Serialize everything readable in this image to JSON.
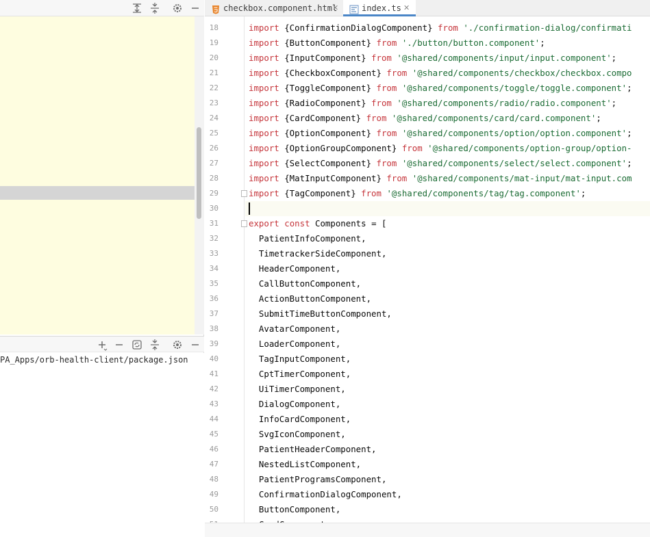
{
  "left_panel": {
    "top_toolbar_icons": [
      "expand-all-icon",
      "collapse-all-icon",
      "gear-icon",
      "minimize-icon"
    ],
    "bottom_toolbar_icons": [
      "add-icon",
      "remove-icon",
      "refresh-icon",
      "collapse-all-icon",
      "gear-icon",
      "minimize-icon"
    ],
    "package_path": "PA_Apps/orb-health-client/package.json"
  },
  "tabs": [
    {
      "label": "checkbox.component.html",
      "icon": "html-file-icon",
      "active": false
    },
    {
      "label": "index.ts",
      "icon": "ts-file-icon",
      "active": true
    }
  ],
  "editor": {
    "current_line": 30,
    "lines": [
      {
        "n": "18",
        "kind": "import",
        "name": "{ConfirmationDialogComponent}",
        "path": "'./confirmation-dialog/confirmati"
      },
      {
        "n": "19",
        "kind": "import",
        "name": "{ButtonComponent}",
        "path": "'./button/button.component'",
        "tail": ";"
      },
      {
        "n": "20",
        "kind": "import",
        "name": "{InputComponent}",
        "path": "'@shared/components/input/input.component'",
        "tail": ";"
      },
      {
        "n": "21",
        "kind": "import",
        "name": "{CheckboxComponent}",
        "path": "'@shared/components/checkbox/checkbox.compo"
      },
      {
        "n": "22",
        "kind": "import",
        "name": "{ToggleComponent}",
        "path": "'@shared/components/toggle/toggle.component'",
        "tail": ";"
      },
      {
        "n": "23",
        "kind": "import",
        "name": "{RadioComponent}",
        "path": "'@shared/components/radio/radio.component'",
        "tail": ";"
      },
      {
        "n": "24",
        "kind": "import",
        "name": "{CardComponent}",
        "path": "'@shared/components/card/card.component'",
        "tail": ";"
      },
      {
        "n": "25",
        "kind": "import",
        "name": "{OptionComponent}",
        "path": "'@shared/components/option/option.component'",
        "tail": ";"
      },
      {
        "n": "26",
        "kind": "import",
        "name": "{OptionGroupComponent}",
        "path": "'@shared/components/option-group/option-"
      },
      {
        "n": "27",
        "kind": "import",
        "name": "{SelectComponent}",
        "path": "'@shared/components/select/select.component'",
        "tail": ";"
      },
      {
        "n": "28",
        "kind": "import",
        "name": "{MatInputComponent}",
        "path": "'@shared/components/mat-input/mat-input.com"
      },
      {
        "n": "29",
        "kind": "import",
        "name": "{TagComponent}",
        "path": "'@shared/components/tag/tag.component'",
        "tail": ";"
      },
      {
        "n": "30",
        "kind": "blank"
      },
      {
        "n": "31",
        "kind": "export",
        "text": "Components = ["
      },
      {
        "n": "32",
        "kind": "item",
        "text": "PatientInfoComponent,"
      },
      {
        "n": "33",
        "kind": "item",
        "text": "TimetrackerSideComponent,"
      },
      {
        "n": "34",
        "kind": "item",
        "text": "HeaderComponent,"
      },
      {
        "n": "35",
        "kind": "item",
        "text": "CallButtonComponent,"
      },
      {
        "n": "36",
        "kind": "item",
        "text": "ActionButtonComponent,"
      },
      {
        "n": "37",
        "kind": "item",
        "text": "SubmitTimeButtonComponent,"
      },
      {
        "n": "38",
        "kind": "item",
        "text": "AvatarComponent,"
      },
      {
        "n": "39",
        "kind": "item",
        "text": "LoaderComponent,"
      },
      {
        "n": "40",
        "kind": "item",
        "text": "TagInputComponent,"
      },
      {
        "n": "41",
        "kind": "item",
        "text": "CptTimerComponent,"
      },
      {
        "n": "42",
        "kind": "item",
        "text": "UiTimerComponent,"
      },
      {
        "n": "43",
        "kind": "item",
        "text": "DialogComponent,"
      },
      {
        "n": "44",
        "kind": "item",
        "text": "InfoCardComponent,"
      },
      {
        "n": "45",
        "kind": "item",
        "text": "SvgIconComponent,"
      },
      {
        "n": "46",
        "kind": "item",
        "text": "PatientHeaderComponent,"
      },
      {
        "n": "47",
        "kind": "item",
        "text": "NestedListComponent,"
      },
      {
        "n": "48",
        "kind": "item",
        "text": "PatientProgramsComponent,"
      },
      {
        "n": "49",
        "kind": "item",
        "text": "ConfirmationDialogComponent,"
      },
      {
        "n": "50",
        "kind": "item",
        "text": "ButtonComponent,"
      },
      {
        "n": "51",
        "kind": "item",
        "text": "CardComponent,"
      }
    ],
    "keywords": {
      "import": "import",
      "from": "from",
      "export": "export",
      "const": "const"
    }
  },
  "colors": {
    "tree_background": "#fefde0",
    "keyword": "#c5343a",
    "string": "#1a6b33",
    "active_tab_underline": "#4a86c7"
  }
}
